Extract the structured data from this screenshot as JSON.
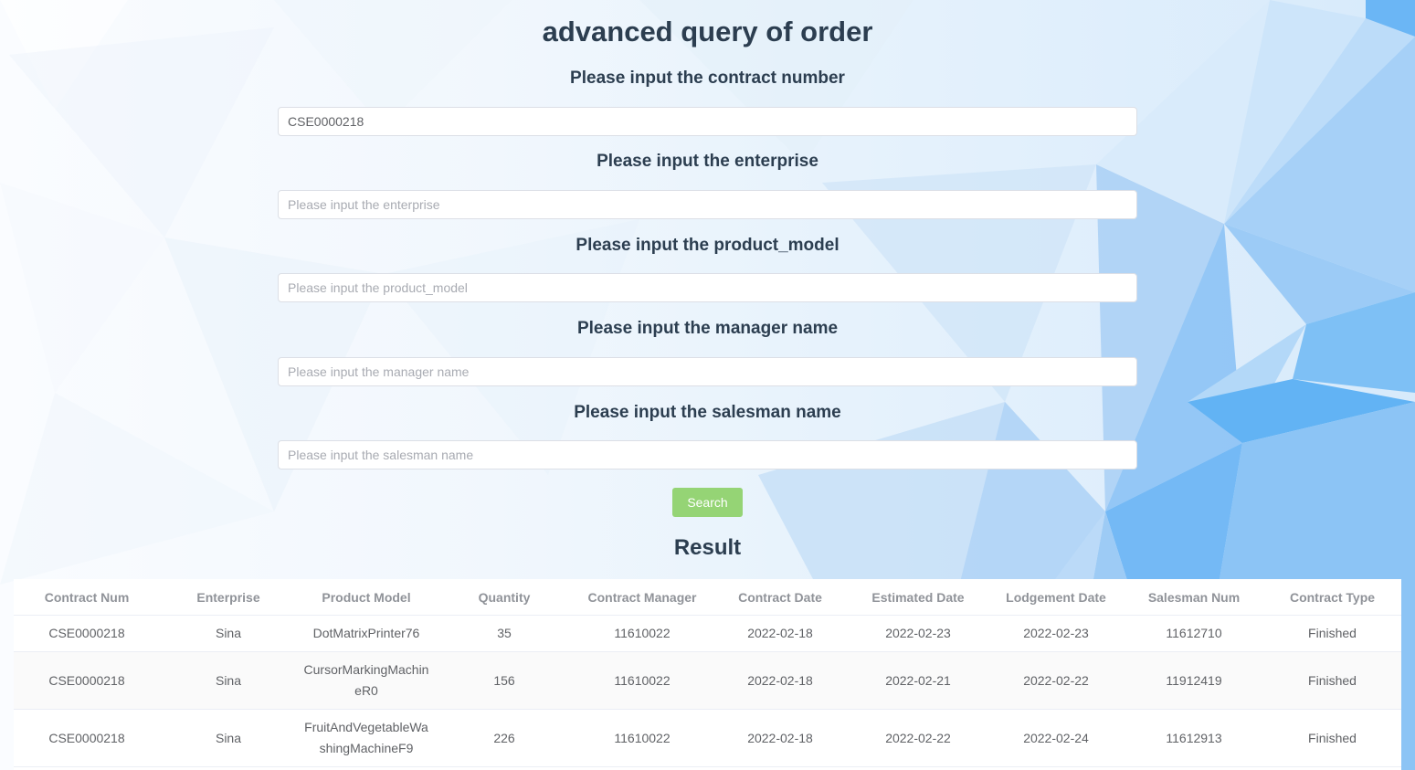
{
  "page": {
    "title": "advanced query of order",
    "search_label": "Search",
    "result_title": "Result"
  },
  "fields": [
    {
      "label": "Please input the contract number",
      "value": "CSE0000218",
      "placeholder": "Please input the contract number"
    },
    {
      "label": "Please input the enterprise",
      "value": "",
      "placeholder": "Please input the enterprise"
    },
    {
      "label": "Please input the product_model",
      "value": "",
      "placeholder": "Please input the product_model"
    },
    {
      "label": "Please input the manager name",
      "value": "",
      "placeholder": "Please input the manager name"
    },
    {
      "label": "Please input the salesman name",
      "value": "",
      "placeholder": "Please input the salesman name"
    }
  ],
  "table": {
    "columns": [
      "Contract Num",
      "Enterprise",
      "Product Model",
      "Quantity",
      "Contract Manager",
      "Contract Date",
      "Estimated Date",
      "Lodgement Date",
      "Salesman Num",
      "Contract Type"
    ],
    "rows": [
      [
        "CSE0000218",
        "Sina",
        "DotMatrixPrinter76",
        "35",
        "11610022",
        "2022-02-18",
        "2022-02-23",
        "2022-02-23",
        "11612710",
        "Finished"
      ],
      [
        "CSE0000218",
        "Sina",
        "CursorMarkingMachineR0",
        "156",
        "11610022",
        "2022-02-18",
        "2022-02-21",
        "2022-02-22",
        "11912419",
        "Finished"
      ],
      [
        "CSE0000218",
        "Sina",
        "FruitAndVegetableWashingMachineF9",
        "226",
        "11610022",
        "2022-02-18",
        "2022-02-22",
        "2022-02-24",
        "11612913",
        "Finished"
      ]
    ]
  },
  "colors": {
    "title": "#2c3e50",
    "search_button": "#95d475",
    "header_text": "#909399",
    "cell_text": "#606266"
  }
}
